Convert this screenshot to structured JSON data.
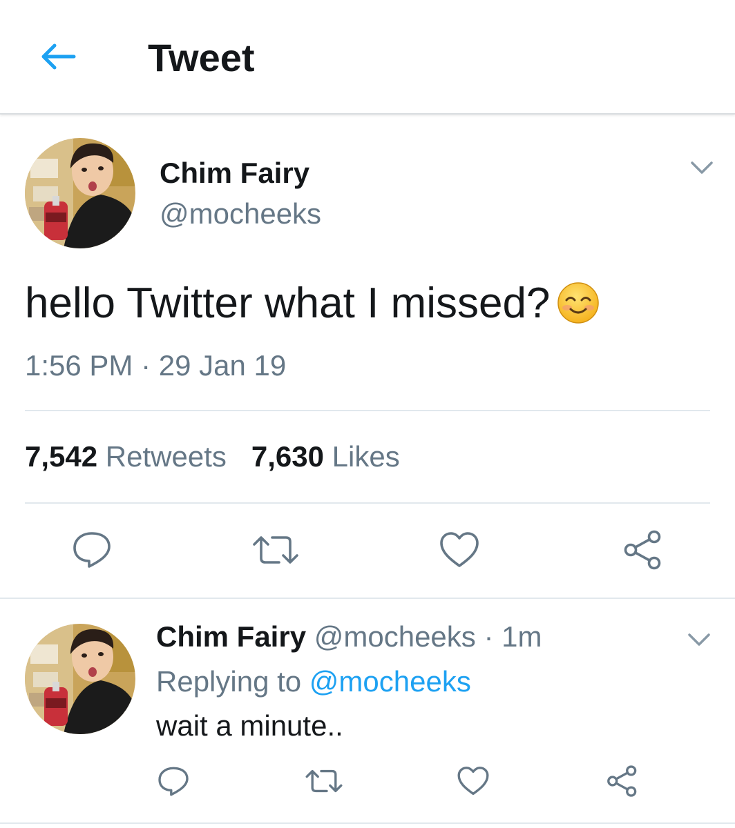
{
  "header": {
    "back_icon": "arrow-left-icon",
    "title": "Tweet"
  },
  "tweet": {
    "name": "Chim Fairy",
    "handle": "@mocheeks",
    "text": "hello Twitter what I missed?",
    "emoji_icon": "smiling-face-icon",
    "timestamp": "1:56 PM · 29 Jan 19",
    "retweets_count": "7,542",
    "retweets_label": "Retweets",
    "likes_count": "7,630",
    "likes_label": "Likes",
    "actions": [
      "reply-icon",
      "retweet-icon",
      "like-icon",
      "share-icon"
    ]
  },
  "reply": {
    "name": "Chim Fairy",
    "meta": "@mocheeks · 1m",
    "replying_prefix": "Replying to",
    "replying_to": "@mocheeks",
    "text": "wait a minute..",
    "actions": [
      "reply-icon",
      "retweet-icon",
      "like-icon",
      "share-icon"
    ]
  },
  "colors": {
    "accent": "#1da1f2",
    "text_primary": "#14171a",
    "text_secondary": "#657786",
    "divider": "#e1e8ed"
  }
}
